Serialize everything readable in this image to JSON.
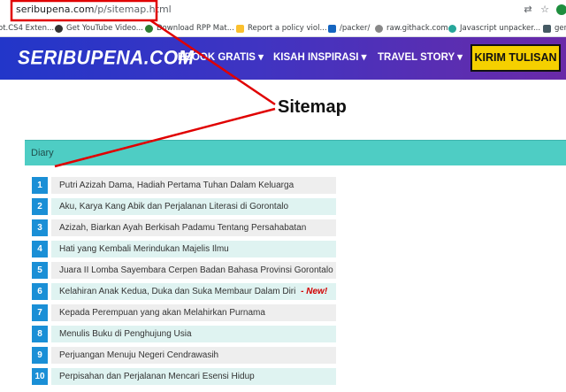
{
  "browser": {
    "url_domain": "seribupena.com",
    "url_path": "/p/sitemap.html",
    "bookmarks": [
      "ot.CS4 Exten...",
      "Get YouTube Video...",
      "Download RPP Mat...",
      "Report a policy viol...",
      "/packer/",
      "raw.githack.com",
      "Javascript unpacker...",
      "gen"
    ],
    "colors": {
      "annotation": "#e00000"
    }
  },
  "site": {
    "logo": "SERIBUPENA.COM",
    "nav": [
      "EBOOK GRATIS ▾",
      "KISAH INSPIRASI ▾",
      "TRAVEL STORY ▾"
    ],
    "cta": "KIRIM TULISAN",
    "colors": {
      "nav_start": "#2236c9",
      "nav_end": "#6a2aa8",
      "cta_bg": "#f5d000"
    }
  },
  "page": {
    "title": "Sitemap",
    "category": "Diary",
    "new_label": "New!",
    "items": [
      {
        "num": "1",
        "title": "Putri Azizah Dama, Hadiah Pertama Tuhan Dalam Keluarga",
        "is_new": false
      },
      {
        "num": "2",
        "title": "Aku, Karya Kang Abik dan Perjalanan Literasi di Gorontalo",
        "is_new": false
      },
      {
        "num": "3",
        "title": "Azizah, Biarkan Ayah Berkisah Padamu Tentang Persahabatan",
        "is_new": false
      },
      {
        "num": "4",
        "title": "Hati yang Kembali Merindukan Majelis Ilmu",
        "is_new": false
      },
      {
        "num": "5",
        "title": "Juara II Lomba Sayembara Cerpen Badan Bahasa Provinsi Gorontalo",
        "is_new": false
      },
      {
        "num": "6",
        "title": "Kelahiran Anak Kedua, Duka dan Suka Membaur Dalam Diri",
        "is_new": true
      },
      {
        "num": "7",
        "title": "Kepada Perempuan yang akan Melahirkan Purnama",
        "is_new": false
      },
      {
        "num": "8",
        "title": "Menulis Buku di Penghujung Usia",
        "is_new": false
      },
      {
        "num": "9",
        "title": "Perjuangan Menuju Negeri Cendrawasih",
        "is_new": false
      },
      {
        "num": "10",
        "title": "Perpisahan dan Perjalanan Mencari Esensi Hidup",
        "is_new": false
      }
    ]
  }
}
